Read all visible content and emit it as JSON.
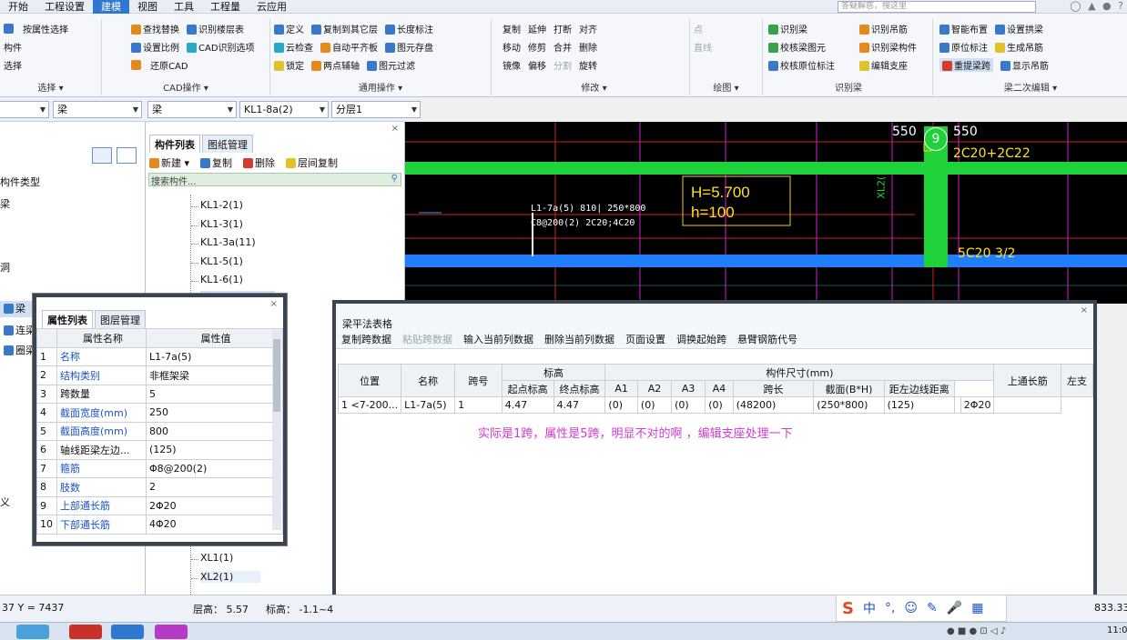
{
  "menu": [
    "开始",
    "工程设置",
    "建模",
    "视图",
    "工具",
    "工程量",
    "云应用"
  ],
  "menu_active": 2,
  "search_placeholder": "答疑解惑，搜这里",
  "ribbon": {
    "select": {
      "items": [
        "按属性选择",
        "构件",
        "选择"
      ],
      "label": "选择 ▾"
    },
    "cad": {
      "items": [
        "查找替换",
        "识别楼层表",
        "设置比例",
        "CAD识别选项",
        "还原CAD"
      ],
      "label": "CAD操作 ▾"
    },
    "common": {
      "items": [
        "定义",
        "复制到其它层",
        "长度标注",
        "云检查",
        "自动平齐板",
        "图元存盘",
        "锁定",
        "两点辅轴",
        "图元过滤"
      ],
      "label": "通用操作 ▾"
    },
    "modify": {
      "items": [
        "复制",
        "延伸",
        "打断",
        "对齐",
        "移动",
        "修剪",
        "合并",
        "删除",
        "镜像",
        "偏移",
        "分割",
        "旋转"
      ],
      "label": "修改 ▾"
    },
    "draw": {
      "items": [
        "点",
        "直线"
      ],
      "label": "绘图 ▾"
    },
    "identify": {
      "items": [
        "识别梁",
        "识别吊筋",
        "校核梁图元",
        "识别梁构件",
        "校核原位标注",
        "编辑支座"
      ],
      "label": "识别梁"
    },
    "beam2": {
      "items": [
        "智能布置",
        "设置拱梁",
        "原位标注",
        "生成吊筋",
        "重提梁跨",
        "显示吊筋"
      ],
      "label": "梁二次编辑 ▾"
    }
  },
  "combos": [
    "梁",
    "梁",
    "KL1-8a(2)",
    "分层1"
  ],
  "left_panel": {
    "items": [
      "构件类型",
      "梁",
      "连梁",
      "圈梁"
    ],
    "side_labels": [
      "梁",
      "洞",
      "义"
    ]
  },
  "component_list": {
    "tabs": [
      "构件列表",
      "图纸管理"
    ],
    "toolbar": [
      "新建 ▾",
      "复制",
      "删除",
      "层间复制"
    ],
    "search": "搜索构件...",
    "items": [
      "KL1-2(1)",
      "KL1-3(1)",
      "KL1-3a(11)",
      "KL1-5(1)",
      "KL1-6(1)"
    ],
    "items_bottom": [
      "XL1(1)",
      "XL2(1)"
    ]
  },
  "cad": {
    "lines": [
      "L1-7a(5)  810| 250*800",
      "C8@200(2) 2C20;4C20"
    ],
    "box": [
      "H=5.700",
      "h=100"
    ],
    "top_right": [
      "550",
      "9",
      "550",
      "2C20+2C22",
      "5C20 3/2",
      "XL2(1)"
    ]
  },
  "attr_dialog": {
    "tabs": [
      "属性列表",
      "图层管理"
    ],
    "headers": [
      "属性名称",
      "属性值"
    ],
    "rows": [
      [
        "1",
        "名称",
        "L1-7a(5)"
      ],
      [
        "2",
        "结构类别",
        "非框架梁"
      ],
      [
        "3",
        "跨数量",
        "5"
      ],
      [
        "4",
        "截面宽度(mm)",
        "250"
      ],
      [
        "5",
        "截面高度(mm)",
        "800"
      ],
      [
        "6",
        "轴线距梁左边...",
        "(125)"
      ],
      [
        "7",
        "箍筋",
        "Φ8@200(2)"
      ],
      [
        "8",
        "肢数",
        "2"
      ],
      [
        "9",
        "上部通长筋",
        "2Φ20"
      ],
      [
        "10",
        "下部通长筋",
        "4Φ20"
      ]
    ]
  },
  "beam_dialog": {
    "title": "梁平法表格",
    "buttons": [
      "复制跨数据",
      "粘贴跨数据",
      "输入当前列数据",
      "删除当前列数据",
      "页面设置",
      "调换起始跨",
      "悬臂钢筋代号"
    ],
    "header_top": [
      "位置",
      "名称",
      "跨号",
      "标高",
      "构件尺寸(mm)",
      "上通长筋",
      "左支"
    ],
    "header_sub": [
      "起点标高",
      "终点标高",
      "A1",
      "A2",
      "A3",
      "A4",
      "跨长",
      "截面(B*H)",
      "距左边线距离"
    ],
    "row": [
      "1",
      "<7-200...",
      "L1-7a(5)",
      "1",
      "4.47",
      "4.47",
      "(0)",
      "(0)",
      "(0)",
      "(0)",
      "(48200)",
      "(250*800)",
      "(125)",
      "2Φ20",
      ""
    ],
    "note": "实际是1跨，属性是5跨，明显不对的啊 ，编辑支座处理一下"
  },
  "status": {
    "coord": "37 Y = 7437",
    "floor_height": "层高：  5.57",
    "elevation": "标高： -1.1~4",
    "right": "833.33"
  },
  "ime": [
    "S",
    "中",
    "°,",
    "☺",
    "✎",
    "🎤",
    "▦"
  ],
  "clock": "11:0"
}
